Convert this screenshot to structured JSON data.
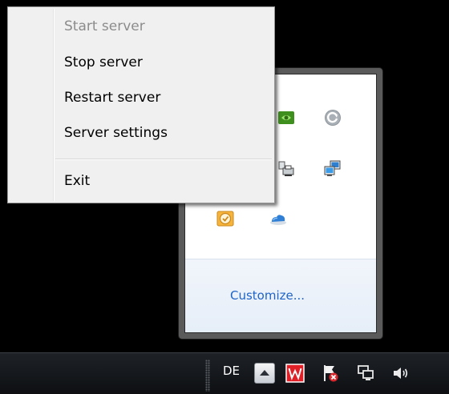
{
  "context_menu": {
    "items": [
      {
        "label": "Start server",
        "disabled": true
      },
      {
        "label": "Stop server",
        "disabled": false
      },
      {
        "label": "Restart server",
        "disabled": false
      },
      {
        "label": "Server settings",
        "disabled": false
      },
      {
        "label": "Exit",
        "disabled": false
      }
    ]
  },
  "tray_flyout": {
    "customize_label": "Customize...",
    "icons": [
      "nvidia-icon",
      "refresh-icon",
      "network-printer-icon",
      "network-computers-icon",
      "clock-app-icon",
      "cloud-icon"
    ]
  },
  "taskbar": {
    "language": "DE",
    "icons": [
      "show-hidden-icons-icon",
      "red-w-app-icon",
      "action-center-flag-icon",
      "network-icon",
      "volume-icon"
    ]
  },
  "colors": {
    "menu_bg": "#f0f0f0",
    "link": "#1e64c8",
    "taskbar_bg": "#14171b"
  }
}
